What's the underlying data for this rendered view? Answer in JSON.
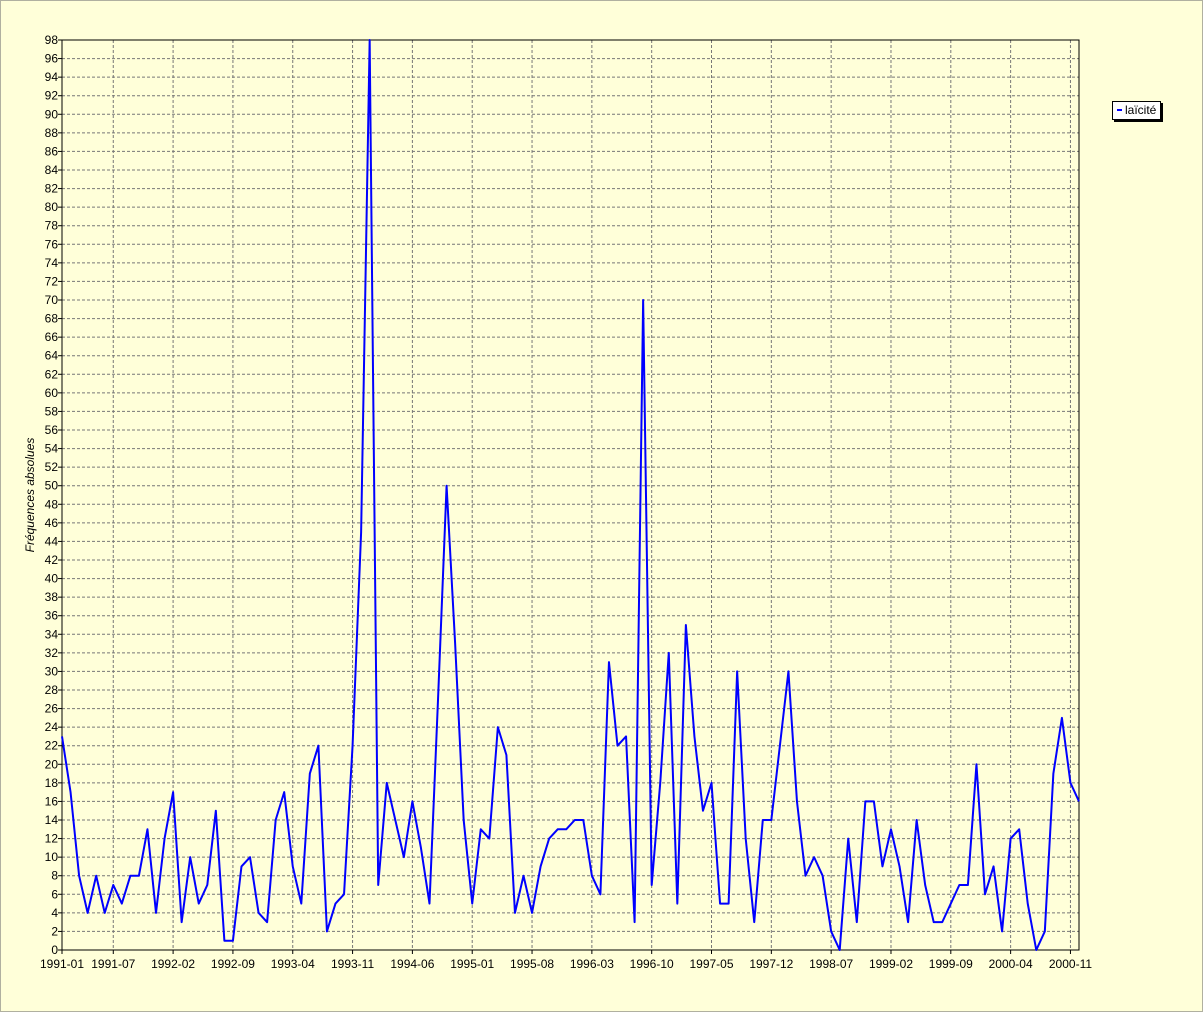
{
  "chart_data": {
    "type": "line",
    "ylabel": "Fréquences absolues",
    "xlabel": "",
    "ylim": [
      0,
      98
    ],
    "y_tick_step": 2,
    "grid": true,
    "legend_position": "right",
    "series_color": "#0000FF",
    "x_tick_labels": [
      "1991-01",
      "1991-07",
      "1992-02",
      "1992-09",
      "1993-04",
      "1993-11",
      "1994-06",
      "1995-01",
      "1995-08",
      "1996-03",
      "1996-10",
      "1997-05",
      "1997-12",
      "1998-07",
      "1999-02",
      "1999-09",
      "2000-04",
      "2000-11"
    ],
    "x_start": "1991-01",
    "x_end": "2000-12",
    "series": [
      {
        "name": "laïcité",
        "values": [
          23,
          17,
          8,
          4,
          8,
          4,
          7,
          5,
          8,
          8,
          13,
          4,
          12,
          17,
          3,
          10,
          5,
          7,
          15,
          1,
          1,
          9,
          10,
          4,
          3,
          14,
          17,
          9,
          5,
          19,
          22,
          2,
          5,
          6,
          22,
          45,
          98,
          7,
          18,
          14,
          10,
          16,
          11,
          5,
          27,
          50,
          33,
          14,
          5,
          13,
          12,
          24,
          21,
          4,
          8,
          4,
          9,
          12,
          13,
          13,
          14,
          14,
          8,
          6,
          31,
          22,
          23,
          3,
          70,
          7,
          18,
          32,
          5,
          35,
          23,
          15,
          18,
          5,
          5,
          30,
          12,
          3,
          14,
          14,
          22,
          30,
          16,
          8,
          10,
          8,
          2,
          0,
          12,
          3,
          16,
          16,
          9,
          13,
          9,
          3,
          14,
          7,
          3,
          3,
          5,
          7,
          7,
          20,
          6,
          9,
          2,
          12,
          13,
          5,
          0,
          2,
          19,
          25,
          18,
          16
        ]
      }
    ]
  }
}
